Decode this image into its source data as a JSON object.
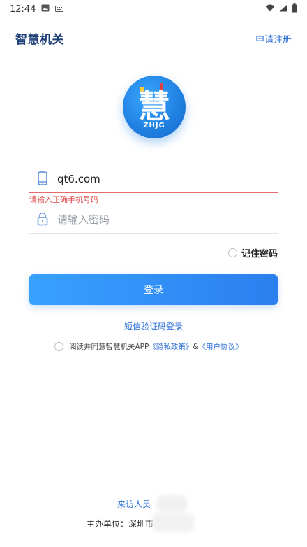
{
  "status_bar": {
    "time": "12:44"
  },
  "header": {
    "app_title": "智慧机关",
    "register_label": "申请注册"
  },
  "logo": {
    "char": "慧",
    "abbr": "ZHJG"
  },
  "phone_field": {
    "value": "qt6.com",
    "error": "请输入正确手机号码"
  },
  "password_field": {
    "placeholder": "请输入密码"
  },
  "remember": {
    "label": "记住密码"
  },
  "login_button": {
    "label": "登录"
  },
  "sms_login": {
    "label": "短信验证码登录"
  },
  "agreement": {
    "prefix": "阅读并同意智慧机关APP",
    "privacy_link": "《隐私政策》",
    "joiner": "&",
    "terms_link": "《用户协议》"
  },
  "footer": {
    "visitor_label": "来访人员",
    "host_label": "主办单位：深圳市"
  },
  "colors": {
    "accent": "#2c6fd6",
    "title": "#1d3f78",
    "error": "#e04848"
  }
}
